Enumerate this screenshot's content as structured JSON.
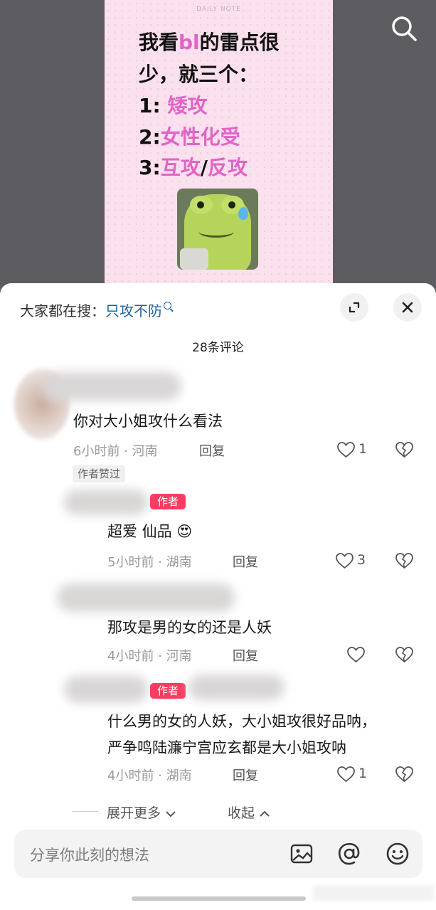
{
  "video": {
    "note_header": "DAILY NOTE",
    "line1_a": "我看",
    "line1_b": "bl",
    "line1_c": "的雷点很",
    "line2": "少，就三个：",
    "item1_num": "1: ",
    "item1_text": "矮攻",
    "item2_num": "2:",
    "item2_text": "女性化受",
    "item3_num": "3:",
    "item3_a": "互攻",
    "item3_sep": "/",
    "item3_b": "反攻"
  },
  "sheet": {
    "hot_search_label": "大家都在搜：",
    "hot_search_keyword": "只攻不防",
    "comment_count": "28条评论",
    "author_badge": "作者",
    "author_liked": "作者赞过",
    "reply_label": "回复",
    "expand_more": "展开更多",
    "collapse": "收起",
    "input_placeholder": "分享你此刻的想法"
  },
  "comments": [
    {
      "text": "你对大小姐攻什么看法",
      "meta": "6小时前 · 河南",
      "likes": "1"
    },
    {
      "text": "超爱 仙品",
      "emoji": "😍",
      "meta": "5小时前 · 湖南",
      "likes": "3"
    },
    {
      "text": "那攻是男的女的还是人妖",
      "meta": "4小时前 · 河南",
      "likes": ""
    },
    {
      "text_line1": "什么男的女的人妖，大小姐攻很好品呐，",
      "text_line2": "严争鸣陆濂宁宫应玄都是大小姐攻呐",
      "meta": "4小时前 · 湖南",
      "likes": "1"
    }
  ],
  "colors": {
    "accent_pink": "#e064c6",
    "author_badge": "#fa3c61",
    "keyword_blue": "#1d62a8"
  },
  "icons": [
    "search-icon",
    "expand-icon",
    "close-icon",
    "heart-icon",
    "broken-heart-icon",
    "chevron-down-icon",
    "chevron-up-icon",
    "image-icon",
    "at-icon",
    "emoji-icon"
  ]
}
